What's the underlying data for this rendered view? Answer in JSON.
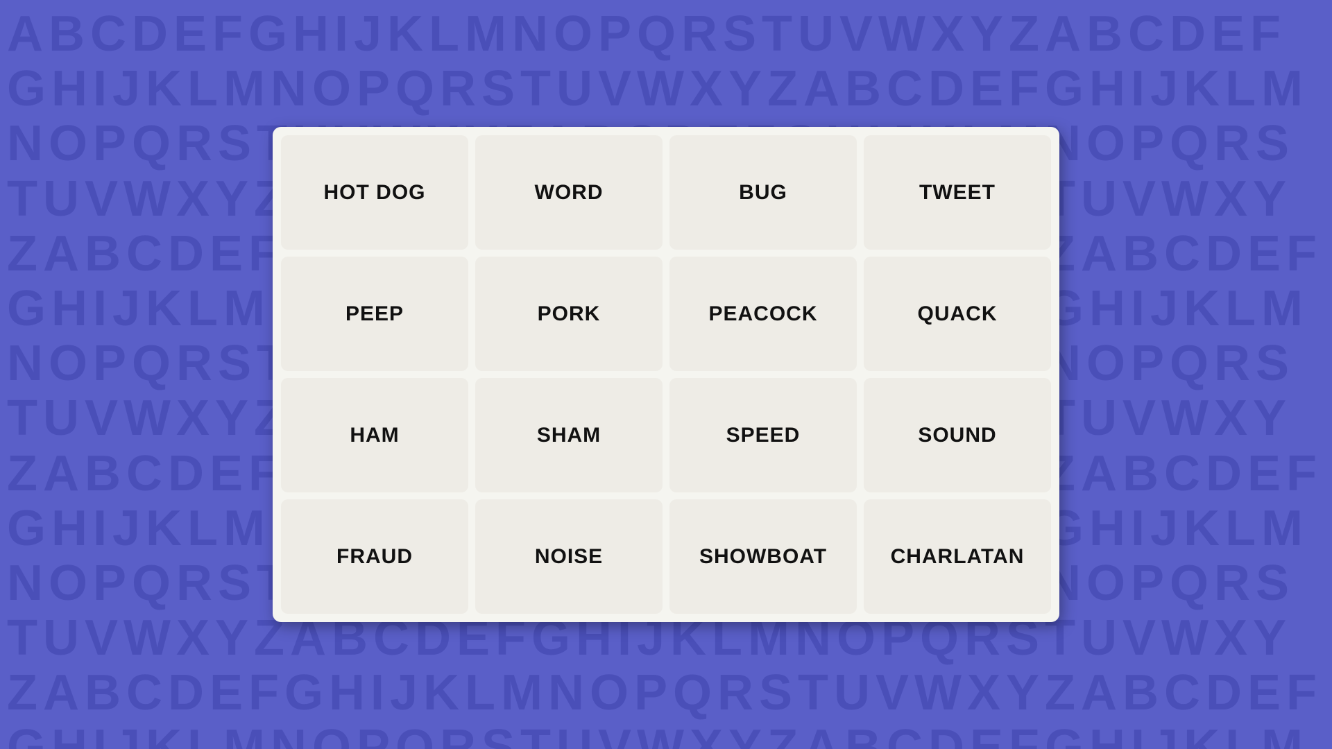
{
  "background": {
    "color": "#5a5fc8",
    "alphabet_text": "ABCDEFGHIJKLMNOPQRSTUVWXYZABCDEFGHIJKLMNOPQRSTUVWXYZABCDEFGHIJKLMNOPQRSTUVWXYZABCDEFGHIJKLMNOPQRSTUVWXYZABCDEFGHIJKLMNOPQRSTUVWXYZABCDEFGHIJKLMNOPQRSTUVWXYZABCDEFGHIJKLMNOPQRSTUVWXYZABCDEFGHIJKLMNOPQRSTUVWXYZABCDEFGHIJKLMNOPQRSTUVWXYZABCDEFGHIJKLMNOPQRSTUVWXYZABCDEFGHIJKLMNOPQRSTUVWXYZABCDEFGHIJKLMNOPQRSTUVWXYZABCDEFGHIJKLMNOPQRSTUVWXYZ"
  },
  "grid": {
    "words": [
      "HOT DOG",
      "WORD",
      "BUG",
      "TWEET",
      "PEEP",
      "PORK",
      "PEACOCK",
      "QUACK",
      "HAM",
      "SHAM",
      "SPEED",
      "SOUND",
      "FRAUD",
      "NOISE",
      "SHOWBOAT",
      "CHARLATAN"
    ]
  }
}
